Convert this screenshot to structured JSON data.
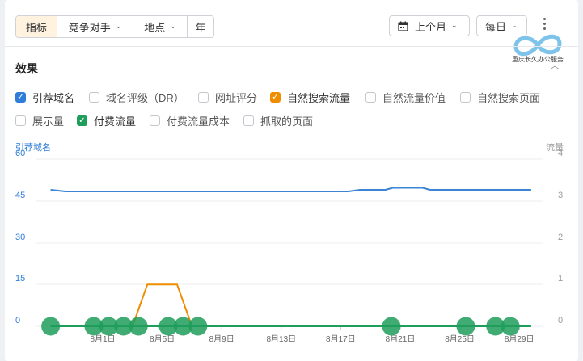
{
  "toolbar": {
    "tabs": [
      {
        "label": "指标",
        "active": true
      },
      {
        "label": "竞争对手",
        "dropdown": true
      },
      {
        "label": "地点",
        "dropdown": true
      },
      {
        "label": "年"
      }
    ],
    "period": "上个月",
    "interval": "每日"
  },
  "logo": {
    "text": "重庆长久办公服务"
  },
  "section": {
    "title": "效果"
  },
  "metrics": [
    {
      "label": "引荐域名",
      "checked": true,
      "color": "#2e7dd8"
    },
    {
      "label": "域名评级（DR）",
      "checked": false
    },
    {
      "label": "网址评分",
      "checked": false
    },
    {
      "label": "自然搜索流量",
      "checked": true,
      "color": "#f08c00"
    },
    {
      "label": "自然流量价值",
      "checked": false
    },
    {
      "label": "自然搜索页面",
      "checked": false
    },
    {
      "label": "展示量",
      "checked": false
    },
    {
      "label": "付费流量",
      "checked": true,
      "color": "#1e9e5a"
    },
    {
      "label": "付费流量成本",
      "checked": false
    },
    {
      "label": "抓取的页面",
      "checked": false
    }
  ],
  "chart_data": {
    "type": "line",
    "left_axis_title": "引荐域名",
    "right_axis_title": "流量",
    "left_ticks": [
      "60",
      "45",
      "30",
      "15",
      "0"
    ],
    "right_ticks": [
      "4",
      "3",
      "2",
      "1",
      "0"
    ],
    "left_range": [
      0,
      60
    ],
    "right_range": [
      0,
      4
    ],
    "x_ticks": [
      "8月1日",
      "8月5日",
      "8月9日",
      "8月13日",
      "8月17日",
      "8月21日",
      "8月25日",
      "8月29日"
    ],
    "x_tick_days": [
      1,
      5,
      9,
      13,
      17,
      21,
      25,
      29
    ],
    "grid": true,
    "series": [
      {
        "name": "引荐域名",
        "axis": "left",
        "color": "#3a86d4",
        "points": [
          [
            -2.5,
            49
          ],
          [
            -1.5,
            48.4
          ],
          [
            0,
            48.4
          ],
          [
            2,
            48.4
          ],
          [
            4,
            48.4
          ],
          [
            6,
            48.4
          ],
          [
            8,
            48.4
          ],
          [
            10,
            48.4
          ],
          [
            12,
            48.4
          ],
          [
            14,
            48.4
          ],
          [
            16,
            48.4
          ],
          [
            17.5,
            48.4
          ],
          [
            18.3,
            49
          ],
          [
            19,
            49
          ],
          [
            20,
            49
          ],
          [
            20.5,
            49.7
          ],
          [
            21,
            49.7
          ],
          [
            22,
            49.7
          ],
          [
            22.5,
            49.7
          ],
          [
            23,
            49
          ],
          [
            24,
            49
          ],
          [
            26,
            49
          ],
          [
            28,
            49
          ],
          [
            29.8,
            49
          ]
        ]
      },
      {
        "name": "自然搜索流量",
        "axis": "right",
        "color": "#f08c00",
        "points": [
          [
            3,
            0
          ],
          [
            4,
            1
          ],
          [
            6,
            1
          ],
          [
            7,
            0
          ]
        ]
      },
      {
        "name": "付费流量",
        "axis": "right",
        "color": "#1e9e5a",
        "points": [
          [
            -2.5,
            0
          ],
          [
            29.8,
            0
          ]
        ],
        "markers": [
          -2.5,
          0.4,
          1.4,
          2.4,
          3.4,
          5.4,
          6.4,
          7.4,
          20.4,
          25.4,
          27.4,
          28.4
        ]
      }
    ]
  }
}
